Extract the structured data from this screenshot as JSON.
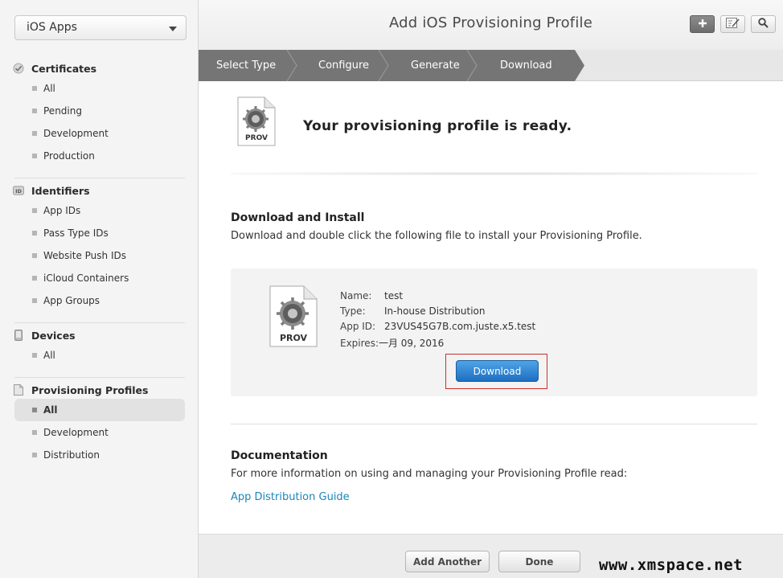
{
  "sidebar": {
    "platform_select": "iOS Apps",
    "sections": [
      {
        "title": "Certificates",
        "icon": "certificate-check-icon",
        "items": [
          "All",
          "Pending",
          "Development",
          "Production"
        ]
      },
      {
        "title": "Identifiers",
        "icon": "id-badge-icon",
        "items": [
          "App IDs",
          "Pass Type IDs",
          "Website Push IDs",
          "iCloud Containers",
          "App Groups"
        ]
      },
      {
        "title": "Devices",
        "icon": "device-icon",
        "items": [
          "All"
        ]
      },
      {
        "title": "Provisioning Profiles",
        "icon": "document-icon",
        "items": [
          "All",
          "Development",
          "Distribution"
        ],
        "active": "All"
      }
    ]
  },
  "header": {
    "title": "Add iOS Provisioning Profile",
    "buttons": [
      "add-icon",
      "edit-icon",
      "search-icon"
    ]
  },
  "steps": [
    "Select Type",
    "Configure",
    "Generate",
    "Download"
  ],
  "main": {
    "hero_title": "Your provisioning profile is ready.",
    "file_icon_label": "PROV",
    "download_heading": "Download and Install",
    "download_text": "Download and double click the following file to install your Provisioning Profile.",
    "profile": {
      "name_label": "Name:",
      "name": "test",
      "type_label": "Type:",
      "type": "In-house Distribution",
      "appid_label": "App ID:",
      "appid": "23VUS45G7B.com.juste.x5.test",
      "expires_label": "Expires:",
      "expires": "一月 09, 2016"
    },
    "download_button": "Download",
    "doc_heading": "Documentation",
    "doc_text": "For more information on using and managing your Provisioning Profile read:",
    "doc_link": "App Distribution Guide"
  },
  "footer": {
    "add_another": "Add Another",
    "done": "Done"
  },
  "watermark": "www.xmspace.net",
  "colors": {
    "step_bar": "#757575",
    "download_button": "#2a7fd0",
    "link": "#1a86b8",
    "highlight_frame": "#c9302c"
  }
}
